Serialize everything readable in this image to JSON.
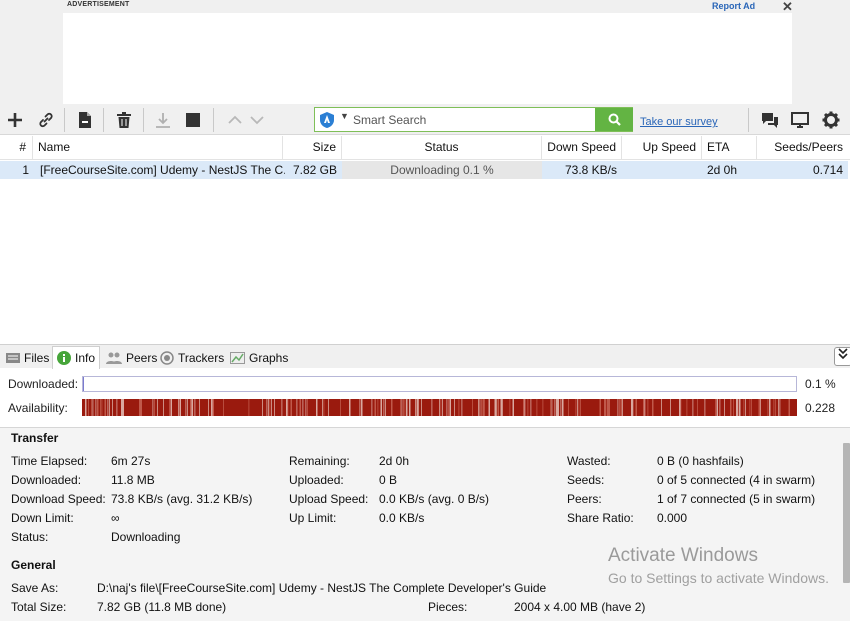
{
  "ad": {
    "label": "ADVERTISEMENT",
    "report": "Report Ad",
    "close": "✕"
  },
  "toolbar": {
    "search_placeholder": "Smart Search",
    "survey_link": "Take our survey"
  },
  "list": {
    "columns": [
      "#",
      "Name",
      "Size",
      "Status",
      "Down Speed",
      "Up Speed",
      "ETA",
      "Seeds/Peers"
    ],
    "rows": [
      {
        "num": "1",
        "name": "[FreeCourseSite.com] Udemy - NestJS The C...",
        "size": "7.82 GB",
        "status": "Downloading 0.1 %",
        "down_speed": "73.8 KB/s",
        "up_speed": "",
        "eta": "2d 0h",
        "seeds_peers": "0.714"
      }
    ]
  },
  "tabs": [
    "Files",
    "Info",
    "Peers",
    "Trackers",
    "Graphs"
  ],
  "active_tab": "Info",
  "bars": {
    "downloaded_label": "Downloaded:",
    "downloaded_value": "0.1 %",
    "downloaded_fraction": 0.001,
    "availability_label": "Availability:",
    "availability_value": "0.228"
  },
  "transfer": {
    "title": "Transfer",
    "col1": [
      {
        "label": "Time Elapsed:",
        "value": "6m 27s"
      },
      {
        "label": "Downloaded:",
        "value": "11.8 MB"
      },
      {
        "label": "Download Speed:",
        "value": "73.8 KB/s (avg. 31.2 KB/s)"
      },
      {
        "label": "Down Limit:",
        "value": "∞"
      },
      {
        "label": "Status:",
        "value": "Downloading"
      }
    ],
    "col2": [
      {
        "label": "Remaining:",
        "value": "2d 0h"
      },
      {
        "label": "Uploaded:",
        "value": "0 B"
      },
      {
        "label": "Upload Speed:",
        "value": "0.0 KB/s (avg. 0 B/s)"
      },
      {
        "label": "Up Limit:",
        "value": "0.0 KB/s"
      }
    ],
    "col3": [
      {
        "label": "Wasted:",
        "value": "0 B (0 hashfails)"
      },
      {
        "label": "Seeds:",
        "value": "0 of 5 connected (4 in swarm)"
      },
      {
        "label": "Peers:",
        "value": "1 of 7 connected (5 in swarm)"
      },
      {
        "label": "Share Ratio:",
        "value": "0.000"
      }
    ]
  },
  "general": {
    "title": "General",
    "save_as_label": "Save As:",
    "save_as_value": "D:\\naj's file\\[FreeCourseSite.com] Udemy - NestJS The Complete Developer's Guide",
    "total_size_label": "Total Size:",
    "total_size_value": "7.82 GB (11.8 MB done)",
    "pieces_label": "Pieces:",
    "pieces_value": "2004 x 4.00 MB (have 2)"
  },
  "watermark": {
    "line1": "Activate Windows",
    "line2": "Go to Settings to activate Windows."
  },
  "colors": {
    "accent_green": "#63b443",
    "link_blue": "#2a66b8",
    "selected_row": "#dbe9f8",
    "availability": "#9a1a0e"
  }
}
